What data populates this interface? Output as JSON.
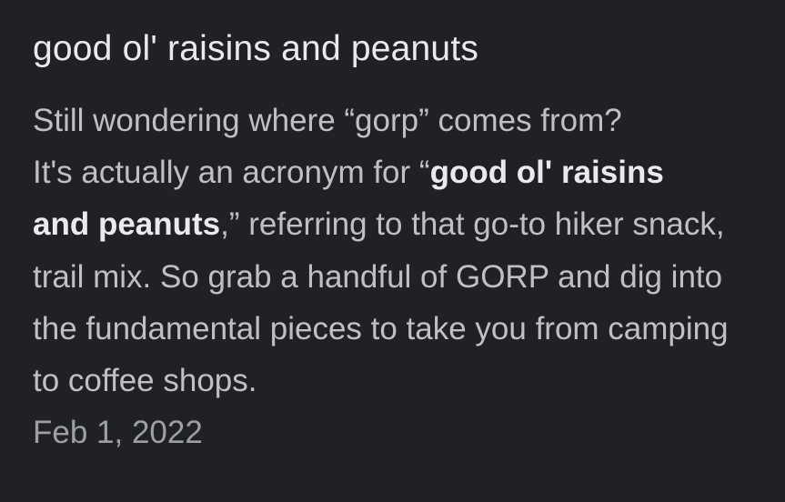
{
  "result": {
    "title": "good ol' raisins and peanuts",
    "snippet": {
      "part1": "Still wondering where “gorp” comes from?",
      "part2": "It's actually an acronym for “",
      "bold_a": "good ol' raisins",
      "bold_b": "and peanuts",
      "part3": ",” referring to that go-to hiker snack, trail mix. So grab a handful of GORP and dig into the fundamental pieces to take you from camping to coffee shops."
    },
    "date": "Feb 1, 2022"
  }
}
